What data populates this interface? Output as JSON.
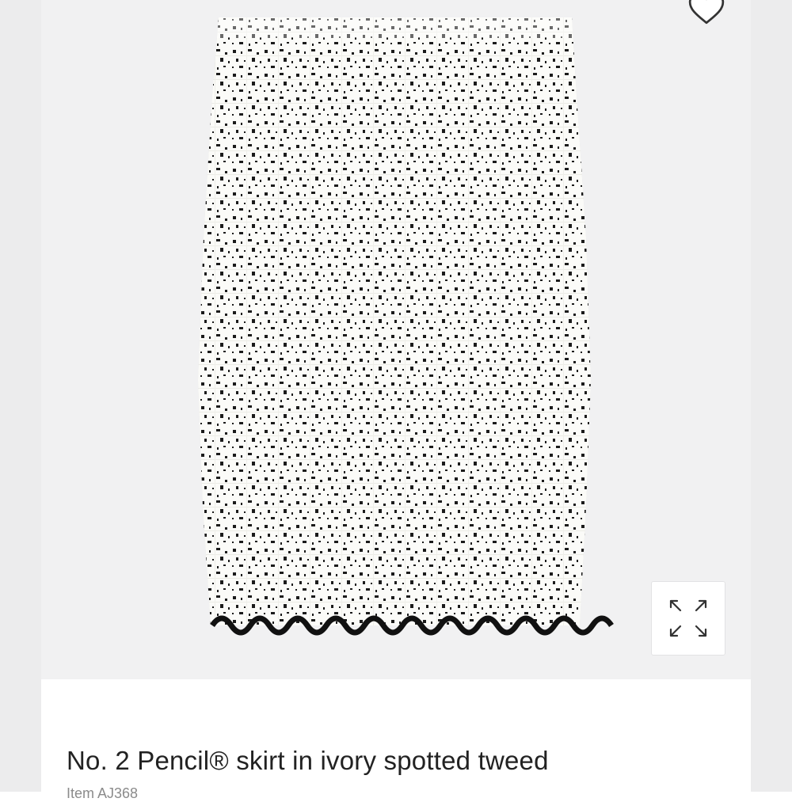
{
  "product": {
    "title": "No. 2 Pencil® skirt in ivory spotted tweed",
    "item_number": "Item AJ368"
  },
  "icons": {
    "favorite": "heart-outline-icon",
    "expand": "expand-arrows-icon"
  },
  "colors": {
    "background": "#f1f1f2",
    "fabric": "#fbfbf8",
    "fleck": "#1b1b1b",
    "trim": "#111111"
  }
}
